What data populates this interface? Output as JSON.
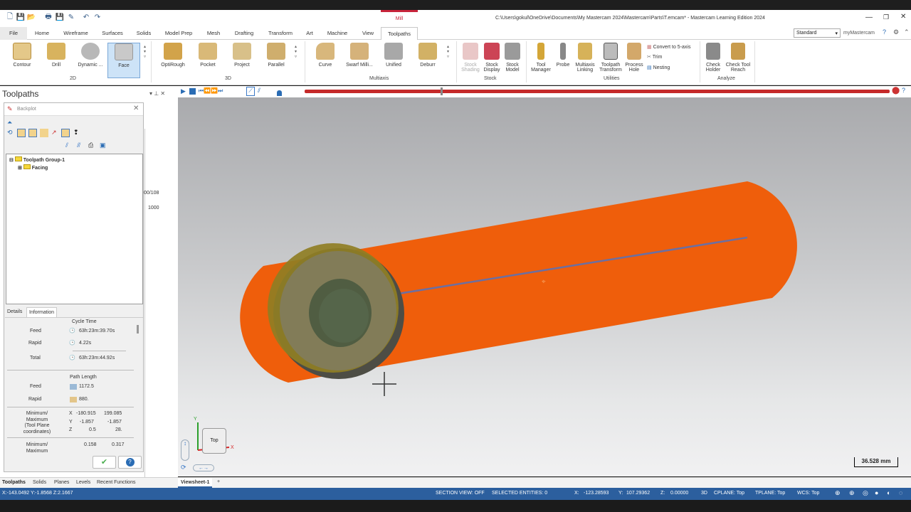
{
  "window": {
    "title": "C:\\Users\\gokul\\OneDrive\\Documents\\My Mastercam 2024\\Mastercam\\Parts\\T.emcam* - Mastercam Learning Edition 2024",
    "context_tab": "Mill",
    "profile": "Standard",
    "account": "myMastercam"
  },
  "tabs": [
    "File",
    "Home",
    "Wireframe",
    "Surfaces",
    "Solids",
    "Model Prep",
    "Mesh",
    "Drafting",
    "Transform",
    "Art",
    "Machine",
    "View",
    "Toolpaths"
  ],
  "ribbon": {
    "g2d": {
      "name": "2D",
      "items": [
        "Contour",
        "Drill",
        "Dynamic ...",
        "Face"
      ]
    },
    "g3d": {
      "name": "3D",
      "items": [
        "OptiRough",
        "Pocket",
        "Project",
        "Parallel"
      ]
    },
    "gmulti": {
      "name": "Multiaxis",
      "items": [
        "Curve",
        "Swarf Milli...",
        "Unified",
        "Deburr"
      ]
    },
    "gstock": {
      "name": "Stock",
      "items": [
        "Stock Shading",
        "Stock Display",
        "Stock Model"
      ]
    },
    "gutil": {
      "name": "Utilities",
      "items": [
        "Tool Manager",
        "Probe",
        "Multiaxis Linking",
        "Toolpath Transform",
        "Process Hole"
      ],
      "small": [
        "Convert to 5-axis",
        "Trim",
        "Nesting"
      ]
    },
    "ganalyze": {
      "name": "Analyze",
      "items": [
        "Check Holder",
        "Check Tool Reach"
      ]
    }
  },
  "panel": {
    "title": "Toolpaths",
    "bg_values": [
      "00/108",
      "1000"
    ]
  },
  "backplot": {
    "title": "Backplot",
    "tree": {
      "group": "Toolpath Group-1",
      "child": "Facing"
    },
    "tabs": [
      "Details",
      "Information"
    ],
    "cycle_time": "Cycle Time",
    "feed_label": "Feed",
    "rapid_label": "Rapid",
    "total_label": "Total",
    "feed_time": "63h:23m:39.70s",
    "rapid_time": "4.22s",
    "total_time": "63h:23m:44.92s",
    "path_length": "Path Length",
    "feed_len": "1172.5",
    "rapid_len": "880.",
    "minmax_label": "Minimum/ Maximum (Tool Plane coordinates)",
    "minmax2_label": "Minimum/ Maximum",
    "x_label": "X",
    "y_label": "Y",
    "z_label": "Z",
    "x_min": "-180.915",
    "x_max": "199.085",
    "y_min": "-1.857",
    "y_max": "-1.857",
    "z_min": "0.5",
    "z_max": "28.",
    "extra_min": "0.158",
    "extra_max": "0.317"
  },
  "view": {
    "scale": "36.528 mm",
    "cube_label": "Top",
    "axis_x": "X",
    "axis_y": "Y",
    "sheet": "Viewsheet-1",
    "plus": "+"
  },
  "bottom_tabs": [
    "Toolpaths",
    "Solids",
    "Planes",
    "Levels",
    "Recent Functions"
  ],
  "status": {
    "coords": "X:-143.0492  Y:-1.8568  Z:2.1667",
    "section": "SECTION VIEW: OFF",
    "selected": "SELECTED ENTITIES: 0",
    "x_label": "X:",
    "x": "-123.28593",
    "y_label": "Y:",
    "y": "107.29362",
    "z_label": "Z:",
    "z": "0.00000",
    "mode": "3D",
    "cplane": "CPLANE: Top",
    "tplane": "TPLANE: Top",
    "wcs": "WCS: Top"
  },
  "colors": {
    "part": "#ef5e0b",
    "status_bar": "#2c5f9e",
    "accent": "#c33"
  }
}
